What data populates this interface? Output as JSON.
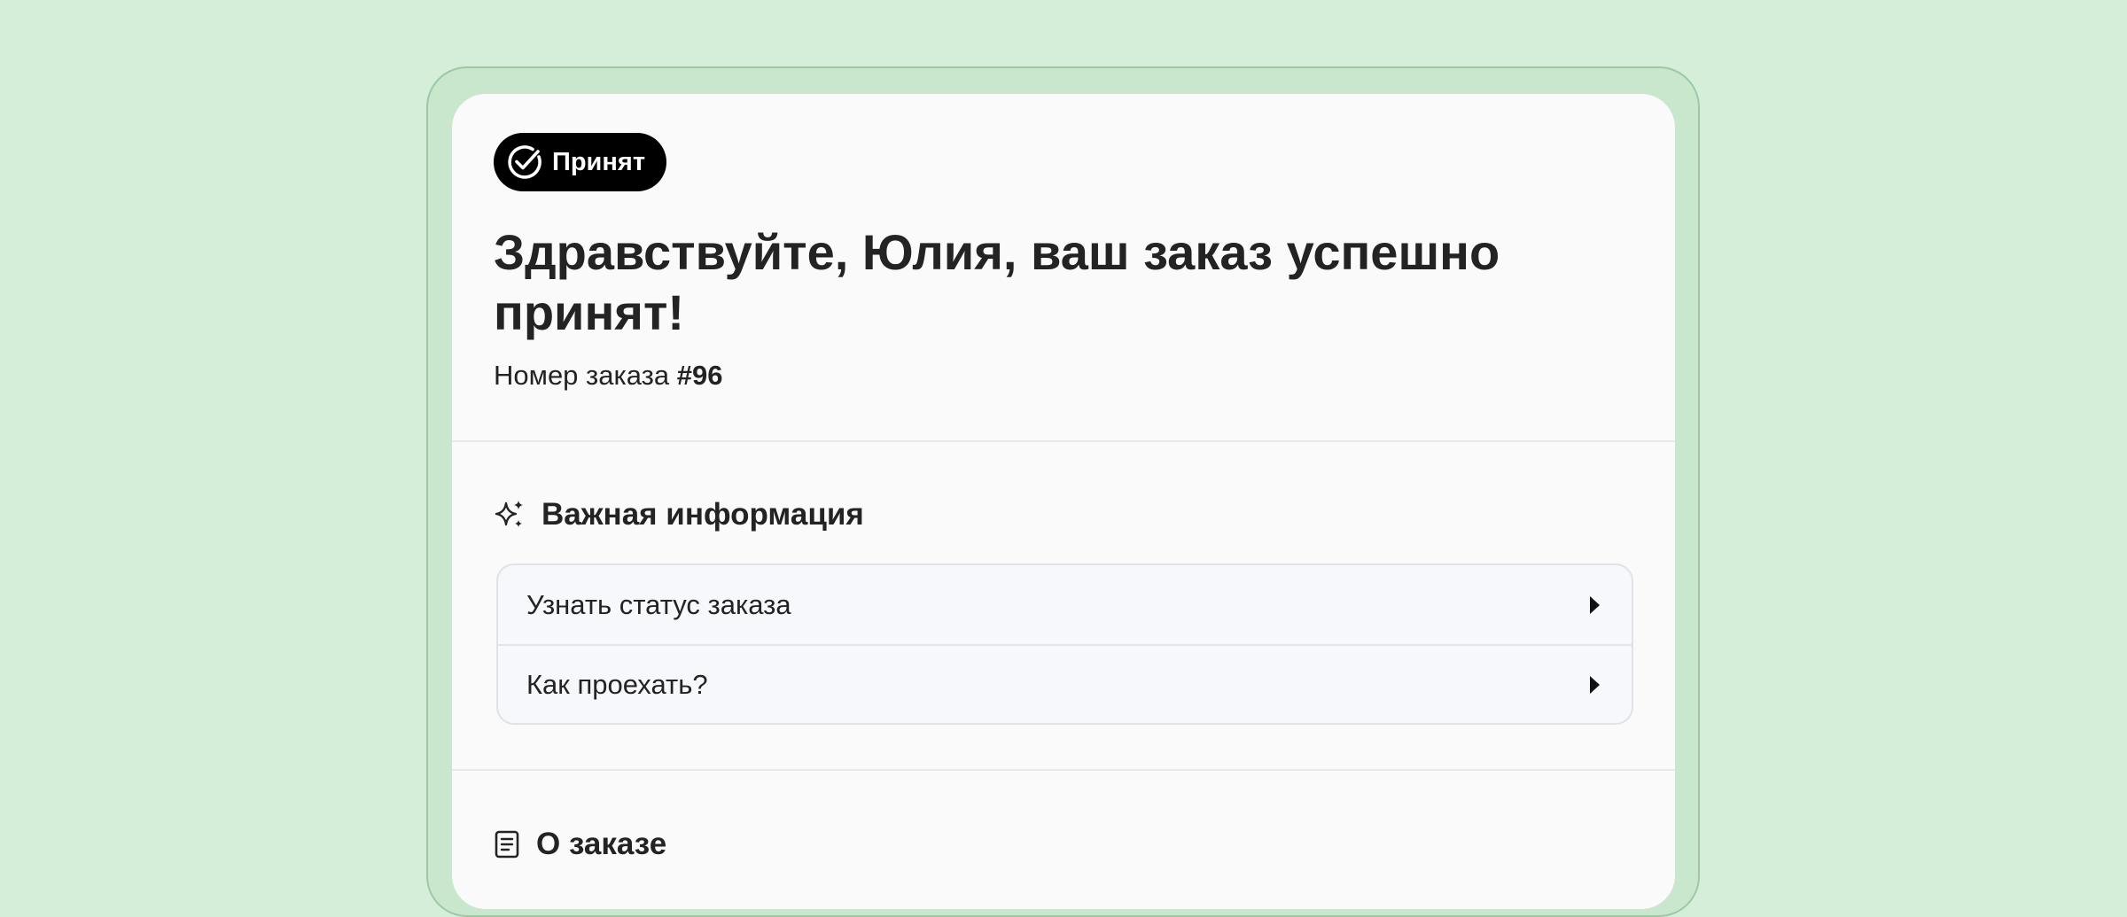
{
  "status": {
    "label": "Принят",
    "icon": "check-circle-icon"
  },
  "header": {
    "greeting": "Здравствуйте, Юлия, ваш заказ успешно принят!",
    "order_label": "Номер заказа",
    "order_number": "#96"
  },
  "important": {
    "title": "Важная информация",
    "icon": "sparkles-icon",
    "items": [
      {
        "label": "Узнать статус заказа",
        "icon": "caret-right-icon"
      },
      {
        "label": "Как проехать?",
        "icon": "caret-right-icon"
      }
    ]
  },
  "about": {
    "title": "О заказе",
    "icon": "document-icon"
  },
  "colors": {
    "background": "#d5eed9",
    "frame": "#c8e7cd",
    "card": "#fafafa",
    "pill": "#000000",
    "text": "#232323"
  }
}
